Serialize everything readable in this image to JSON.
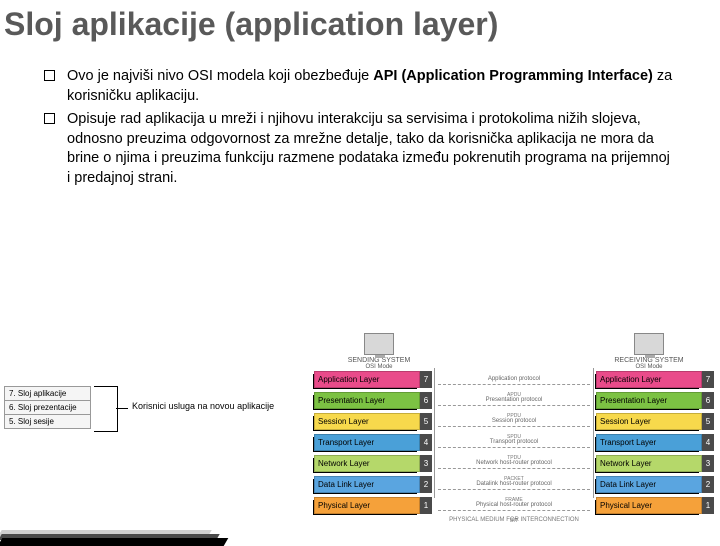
{
  "title": "Sloj aplikacije (application layer)",
  "bullets": [
    "Ovo je najviši nivo OSI modela koji obezbeđuje API (Application Programming Interface) za korisničku aplikaciju.",
    "Opisuje rad aplikacija u mreži i njihovu interakciju sa servisima i protokolima nižih slojeva, odnosno preuzima odgovornost za mrežne detalje, tako da korisnička aplikacija ne mora da brine o njima i preuzima funkciju razmene podataka između pokrenutih programa na prijemnoj i predajnoj strani."
  ],
  "left_layers": [
    "7. Sloj aplikacije",
    "6. Sloj prezentacije",
    "5. Sloj sesije"
  ],
  "left_label": "Korisnici usluga na novou aplikacije",
  "osi": {
    "send": "SENDING SYSTEM",
    "recv": "RECEIVING SYSTEM",
    "mode": "OSI Mode",
    "rows": [
      {
        "name": "Application Layer",
        "num": "7",
        "mid": "Application protocol",
        "pdu": "APDU",
        "cls": "c-app"
      },
      {
        "name": "Presentation Layer",
        "num": "6",
        "mid": "Presentation protocol",
        "pdu": "PPDU",
        "cls": "c-pres"
      },
      {
        "name": "Session Layer",
        "num": "5",
        "mid": "Session protocol",
        "pdu": "SPDU",
        "cls": "c-sess"
      },
      {
        "name": "Transport Layer",
        "num": "4",
        "mid": "Transport protocol",
        "pdu": "TPDU",
        "cls": "c-tran"
      },
      {
        "name": "Network Layer",
        "num": "3",
        "mid": "Network host-router protocol",
        "pdu": "PACKET",
        "cls": "c-net"
      },
      {
        "name": "Data Link Layer",
        "num": "2",
        "mid": "Datalink host-router protocol",
        "pdu": "FRAME",
        "cls": "c-data"
      },
      {
        "name": "Physical Layer",
        "num": "1",
        "mid": "Physical host-router protocol",
        "pdu": "BIT",
        "cls": "c-phys"
      }
    ],
    "medium": "PHYSICAL MEDIUM FOR INTERCONNECTION"
  }
}
